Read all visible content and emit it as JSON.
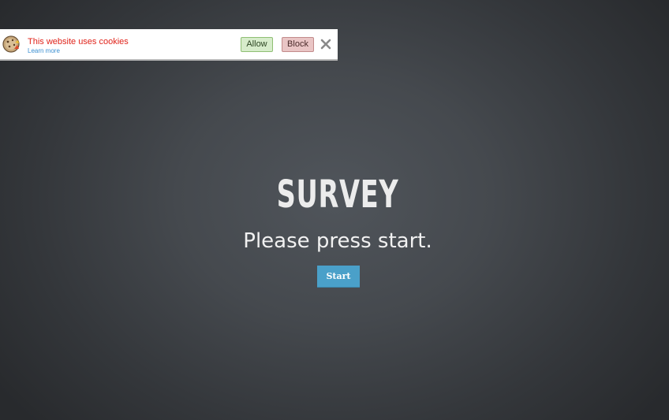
{
  "cookie_banner": {
    "icon": "cookie-icon",
    "message": "This website uses cookies",
    "learn_more": "Learn more",
    "allow_label": "Allow",
    "block_label": "Block",
    "close_icon": "close-icon"
  },
  "survey": {
    "title": "SURVEY",
    "prompt": "Please press start.",
    "start_label": "Start"
  },
  "colors": {
    "background": "#45494e",
    "message_red": "#e0241b",
    "link_blue": "#3b8fd1",
    "allow_green": "#d7eccb",
    "block_red": "#e9c5c5",
    "start_blue": "#4aa0c9"
  }
}
